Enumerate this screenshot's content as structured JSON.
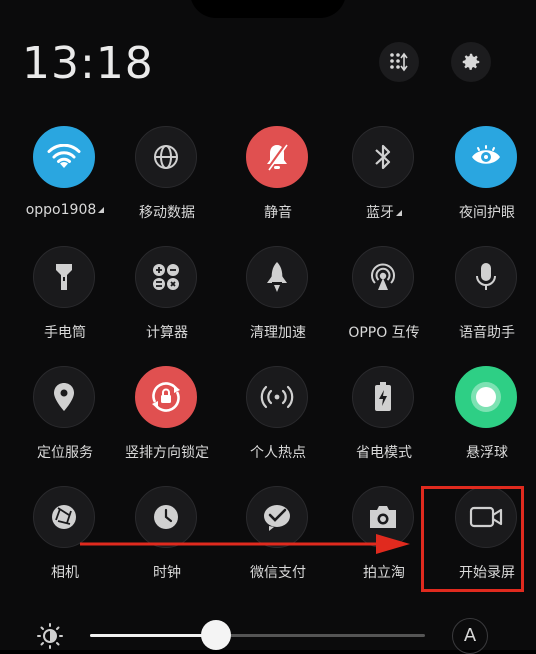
{
  "status": {
    "time": "13:18"
  },
  "tiles": [
    {
      "label": "oppo1908",
      "icon": "wifi-icon",
      "active": true,
      "color": "blue",
      "has_arrow": true
    },
    {
      "label": "移动数据",
      "icon": "globe-icon",
      "active": false
    },
    {
      "label": "静音",
      "icon": "bell-off-icon",
      "active": true,
      "color": "red"
    },
    {
      "label": "蓝牙",
      "icon": "bluetooth-icon",
      "active": false,
      "has_arrow": true
    },
    {
      "label": "夜间护眼",
      "icon": "eye-icon",
      "active": true,
      "color": "blue"
    },
    {
      "label": "手电筒",
      "icon": "flashlight-icon",
      "active": false
    },
    {
      "label": "计算器",
      "icon": "calculator-icon",
      "active": false
    },
    {
      "label": "清理加速",
      "icon": "rocket-icon",
      "active": false
    },
    {
      "label": "OPPO 互传",
      "icon": "share-icon",
      "active": false
    },
    {
      "label": "语音助手",
      "icon": "microphone-icon",
      "active": false
    },
    {
      "label": "定位服务",
      "icon": "location-pin-icon",
      "active": false
    },
    {
      "label": "竖排方向锁定",
      "icon": "rotation-lock-icon",
      "active": true,
      "color": "red"
    },
    {
      "label": "个人热点",
      "icon": "hotspot-icon",
      "active": false
    },
    {
      "label": "省电模式",
      "icon": "battery-saver-icon",
      "active": false
    },
    {
      "label": "悬浮球",
      "icon": "floating-ball-icon",
      "active": true,
      "color": "green"
    },
    {
      "label": "相机",
      "icon": "camera-shutter-icon",
      "active": false
    },
    {
      "label": "时钟",
      "icon": "clock-icon",
      "active": false
    },
    {
      "label": "微信支付",
      "icon": "wechat-pay-icon",
      "active": false
    },
    {
      "label": "拍立淘",
      "icon": "camera-icon",
      "active": false
    },
    {
      "label": "开始录屏",
      "icon": "video-record-icon",
      "active": false
    }
  ],
  "brightness": {
    "level": 0.34,
    "auto_label": "A"
  },
  "colors": {
    "blue": "#2aa6e0",
    "red": "#e05050",
    "green": "#2ecf85",
    "annotation": "#e02a1e"
  }
}
